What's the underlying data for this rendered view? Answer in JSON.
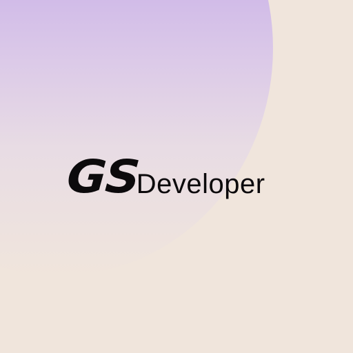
{
  "brand": {
    "mark": "GS",
    "word": "Developer"
  },
  "colors": {
    "background": "#f0e5dc",
    "circle_top": "#b497ec",
    "text": "#0c0a0c"
  }
}
